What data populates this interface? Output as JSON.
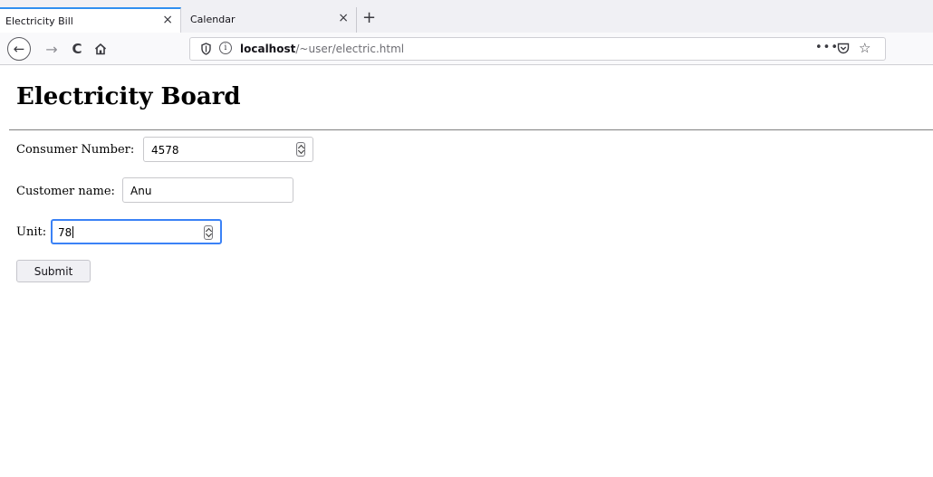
{
  "tabs": [
    {
      "title": "Electricity Bill",
      "close": "×"
    },
    {
      "title": "Calendar",
      "close": "×"
    }
  ],
  "new_tab": "+",
  "nav": {
    "back": "←",
    "forward": "→",
    "reload": "C",
    "url_host": "localhost",
    "url_path": "/~user/electric.html",
    "info": "i",
    "more": "•••",
    "star": "☆"
  },
  "page": {
    "heading": "Electricity Board",
    "form": {
      "consumer_number_label": "Consumer Number:",
      "consumer_number_value": "4578",
      "customer_name_label": "Customer name:",
      "customer_name_value": "Anu",
      "unit_label": "Unit:",
      "unit_value": "78",
      "submit_label": "Submit"
    }
  },
  "colors": {
    "tab_accent": "#2f8ff0",
    "focus_ring": "#3b82f6"
  },
  "icons": [
    "back-arrow-icon",
    "forward-arrow-icon",
    "reload-icon",
    "home-icon",
    "shield-icon",
    "info-icon",
    "more-icon",
    "pocket-icon",
    "star-icon",
    "close-icon",
    "plus-icon",
    "spinner-icon"
  ]
}
